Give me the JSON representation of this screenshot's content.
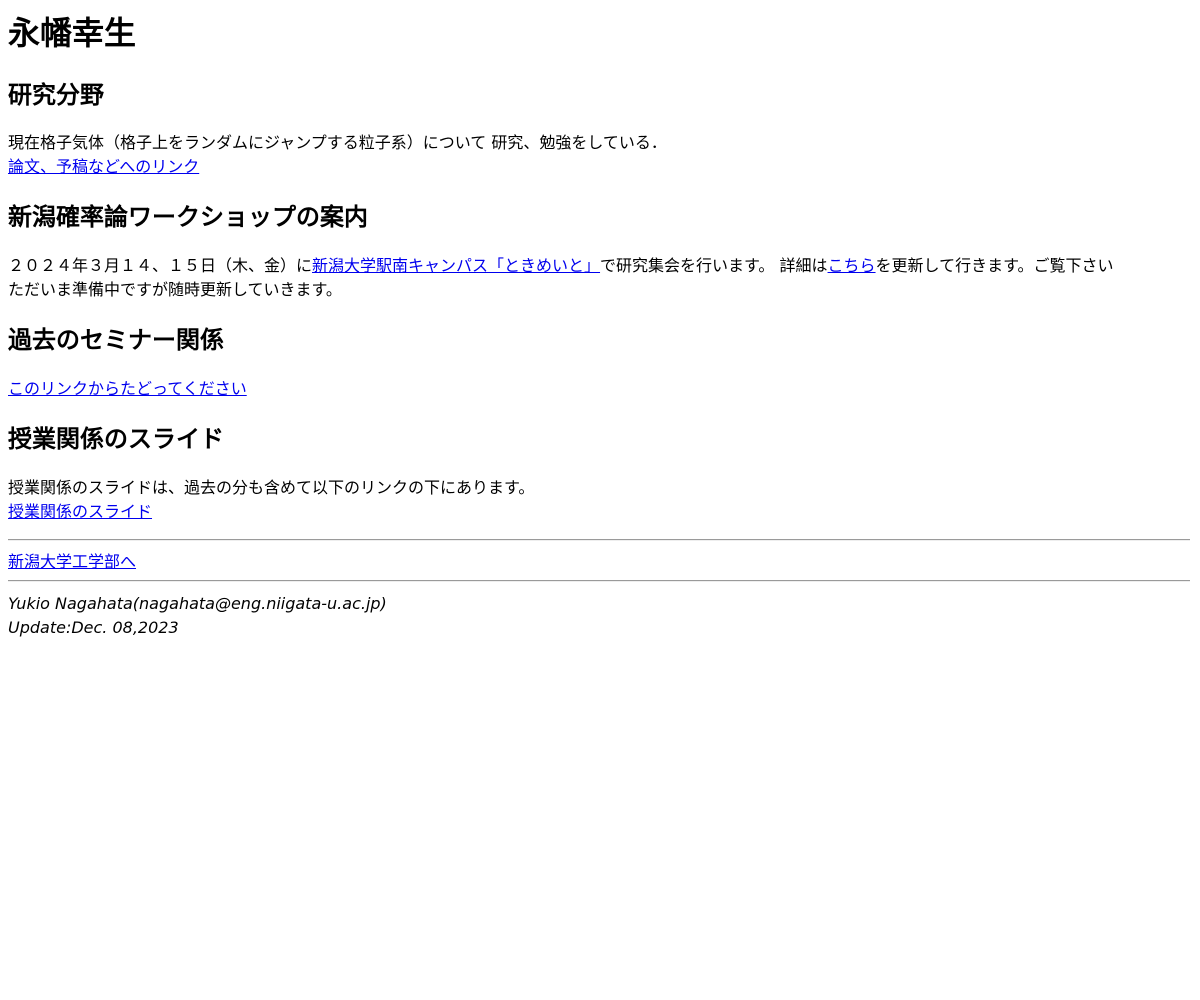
{
  "name_title": "永幡幸生",
  "research": {
    "heading": "研究分野",
    "text": "現在格子気体（格子上をランダムにジャンプする粒子系）について 研究、勉強をしている．",
    "link_label": "論文、予稿などへのリンク"
  },
  "workshop": {
    "heading": "新潟確率論ワークショップの案内",
    "text_before": "２０２４年３月１４、１５日（木、金）に",
    "venue_link": "新潟大学駅南キャンパス「ときめいと」",
    "text_middle": "で研究集会を行います。 詳細は",
    "details_link": "こちら",
    "text_after": "を更新して行きます。ご覧下さい",
    "note": "ただいま準備中ですが随時更新していきます。"
  },
  "seminar": {
    "heading": "過去のセミナー関係",
    "link_label": "このリンクからたどってください"
  },
  "lectures": {
    "heading": "授業関係のスライド",
    "text": "授業関係のスライドは、過去の分も含めて以下のリンクの下にあります。",
    "link_label": "授業関係のスライド"
  },
  "faculty_link": "新潟大学工学部へ",
  "footer": {
    "contact": "Yukio Nagahata(nagahata@eng.niigata-u.ac.jp)",
    "update": "Update:Dec. 08,2023"
  },
  "colors": {
    "link": "#0000ee",
    "text": "#000000",
    "background": "#ffffff"
  }
}
